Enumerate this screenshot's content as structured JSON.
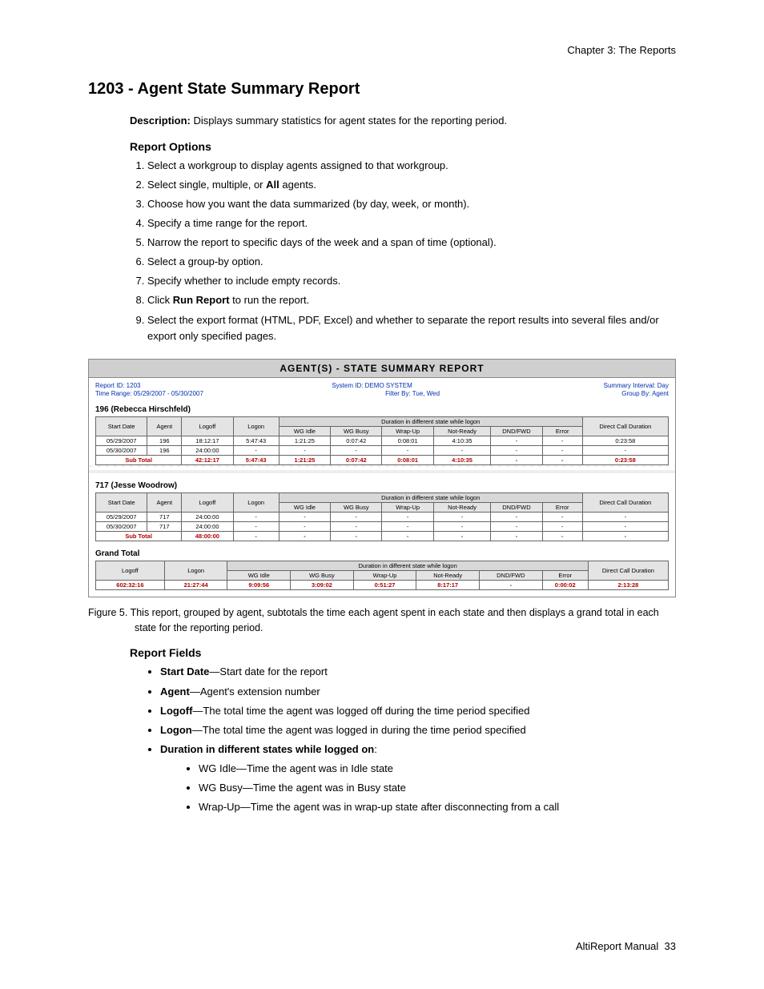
{
  "chapter": "Chapter 3:  The Reports",
  "heading": "1203 - Agent State Summary Report",
  "description_label": "Description:",
  "description_text": " Displays summary statistics for agent states for the reporting period.",
  "report_options_head": "Report Options",
  "options": {
    "o1": "Select a workgroup to display agents assigned to that workgroup.",
    "o2a": "Select single, multiple, or ",
    "o2b": "All",
    "o2c": " agents.",
    "o3": "Choose how you want the data summarized (by day, week, or month).",
    "o4": "Specify a time range for the report.",
    "o5": "Narrow the report to specific days of the week and a span of time (optional).",
    "o6": "Select a group-by option.",
    "o7": "Specify whether to include empty records.",
    "o8a": "Click ",
    "o8b": "Run Report",
    "o8c": " to run the report.",
    "o9": "Select the export format (HTML, PDF, Excel) and whether to separate the report results into several files and/or export only specified pages."
  },
  "report": {
    "title": "AGENT(S) - STATE SUMMARY REPORT",
    "meta": {
      "left1": "Report ID: 1203",
      "mid1": "System ID: DEMO SYSTEM",
      "right1": "Summary Interval: Day",
      "left2": "Time Range: 05/29/2007 - 05/30/2007",
      "mid2": "Filter By: Tue, Wed",
      "right2": "Group By: Agent"
    },
    "cols": {
      "start": "Start Date",
      "agent": "Agent",
      "logoff": "Logoff",
      "logon": "Logon",
      "span": "Duration in different state while logon",
      "idle": "WG Idle",
      "busy": "WG Busy",
      "wrap": "Wrap-Up",
      "nr": "Not-Ready",
      "dnd": "DND/FWD",
      "err": "Error",
      "dcd": "Direct Call Duration"
    },
    "agent1": {
      "name": "196 (Rebecca Hirschfeld)",
      "rows": [
        {
          "d": "05/29/2007",
          "a": "196",
          "lo": "18:12:17",
          "ln": "5:47:43",
          "id": "1:21:25",
          "bu": "0:07:42",
          "wr": "0:08:01",
          "nr": "4:10:35",
          "dn": "-",
          "er": "-",
          "dc": "0:23:58"
        },
        {
          "d": "05/30/2007",
          "a": "196",
          "lo": "24:00:00",
          "ln": "-",
          "id": "-",
          "bu": "-",
          "wr": "-",
          "nr": "-",
          "dn": "-",
          "er": "-",
          "dc": "-"
        }
      ],
      "subtotal": {
        "label": "Sub Total",
        "lo": "42:12:17",
        "ln": "5:47:43",
        "id": "1:21:25",
        "bu": "0:07:42",
        "wr": "0:08:01",
        "nr": "4:10:35",
        "dn": "-",
        "er": "-",
        "dc": "0:23:58"
      }
    },
    "agent2": {
      "name": "717 (Jesse Woodrow)",
      "rows": [
        {
          "d": "05/29/2007",
          "a": "717",
          "lo": "24:00:00",
          "ln": "-",
          "id": "-",
          "bu": "-",
          "wr": "-",
          "nr": "-",
          "dn": "-",
          "er": "-",
          "dc": "-"
        },
        {
          "d": "05/30/2007",
          "a": "717",
          "lo": "24:00:00",
          "ln": "-",
          "id": "-",
          "bu": "-",
          "wr": "-",
          "nr": "-",
          "dn": "-",
          "er": "-",
          "dc": "-"
        }
      ],
      "subtotal": {
        "label": "Sub Total",
        "lo": "48:00:00",
        "ln": "-",
        "id": "-",
        "bu": "-",
        "wr": "-",
        "nr": "-",
        "dn": "-",
        "er": "-",
        "dc": "-"
      }
    },
    "grand": {
      "label": "Grand Total",
      "cols": {
        "logoff": "Logoff",
        "logon": "Logon",
        "idle": "WG Idle",
        "busy": "WG Busy",
        "wrap": "Wrap-Up",
        "nr": "Not-Ready",
        "dnd": "DND/FWD",
        "err": "Error",
        "dcd": "Direct Call Duration",
        "span": "Duration in different state while logon"
      },
      "row": {
        "lo": "602:32:16",
        "ln": "21:27:44",
        "id": "9:09:56",
        "bu": "3:09:02",
        "wr": "0:51:27",
        "nr": "8:17:17",
        "dn": "-",
        "er": "0:00:02",
        "dc": "2:13:28"
      }
    }
  },
  "figure_caption_a": "Figure 5.   ",
  "figure_caption_b": "This report, grouped by agent, subtotals the time each agent spent in each state and then displays a grand total in each state for the reporting period.",
  "fields_head": "Report Fields",
  "fields": {
    "f1a": "Start Date",
    "f1b": "—Start date for the report",
    "f2a": "Agent",
    "f2b": "—Agent's extension number",
    "f3a": "Logoff",
    "f3b": "—The total time the agent was logged off during the time period specified",
    "f4a": "Logon",
    "f4b": "—The total time the agent was logged in during the time period specified",
    "f5a": "Duration in different states while logged on",
    "f5b": ":",
    "s1": "WG Idle—Time the agent was in Idle state",
    "s2": "WG Busy—Time the agent was in Busy state",
    "s3": "Wrap-Up—Time the agent was in wrap-up state after disconnecting from a call"
  },
  "footer_a": "AltiReport Manual",
  "footer_b": "33"
}
